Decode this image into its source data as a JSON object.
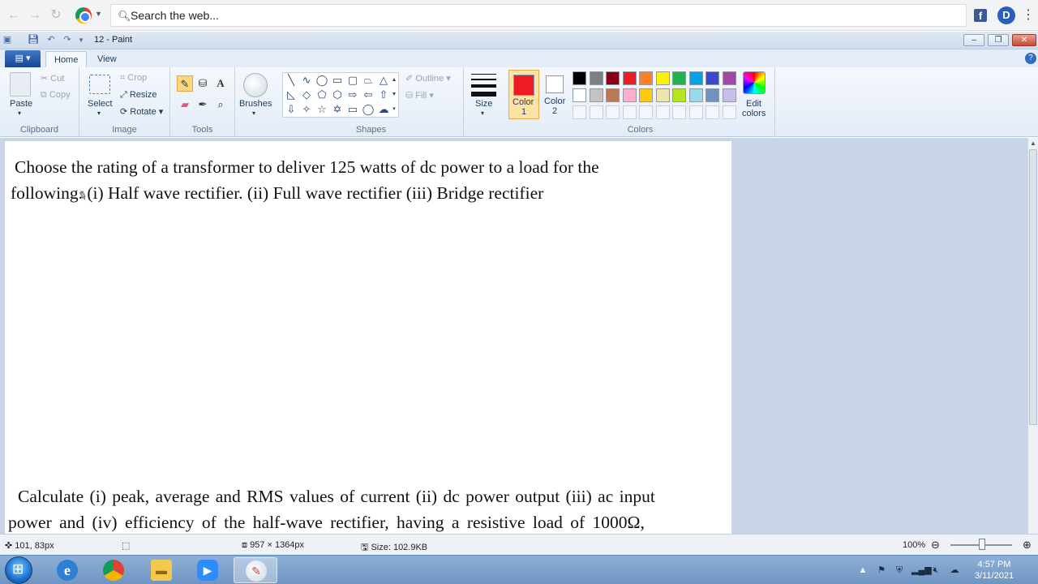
{
  "browser": {
    "search_placeholder": "Search the web...",
    "ext_facebook": "f",
    "ext_d": "D"
  },
  "window": {
    "title": "12 - Paint"
  },
  "ribbon": {
    "tabs": [
      "Home",
      "View"
    ],
    "clipboard": {
      "paste": "Paste",
      "cut": "Cut",
      "copy": "Copy",
      "label": "Clipboard"
    },
    "image": {
      "select": "Select",
      "crop": "Crop",
      "resize": "Resize",
      "rotate": "Rotate",
      "label": "Image"
    },
    "tools": {
      "label": "Tools",
      "text_tool": "A"
    },
    "brushes": {
      "label": "Brushes"
    },
    "shapes": {
      "outline": "Outline",
      "fill": "Fill",
      "label": "Shapes"
    },
    "size": {
      "label": "Size"
    },
    "colors": {
      "color1_label": "Color",
      "color1_num": "1",
      "color2_label": "Color",
      "color2_num": "2",
      "edit_label": "Edit",
      "edit_label2": "colors",
      "label": "Colors",
      "color1": "#ed1c24",
      "color2": "#ffffff",
      "palette_row1": [
        "#000000",
        "#7f7f7f",
        "#880015",
        "#ed1c24",
        "#ff7f27",
        "#fff200",
        "#22b14c",
        "#00a2e8",
        "#3f48cc",
        "#a349a4"
      ],
      "palette_row2": [
        "#ffffff",
        "#c3c3c3",
        "#b97a57",
        "#ffaec9",
        "#ffc90e",
        "#efe4b0",
        "#b5e61d",
        "#99d9ea",
        "#7092be",
        "#c8bfe7"
      ]
    }
  },
  "canvas": {
    "line1": "Choose the rating of a transformer to deliver 125 watts of dc power to a load for the",
    "line2": "following. (i) Half wave rectifier. (ii) Full wave rectifier (iii) Bridge rectifier",
    "line3": "Calculate (i) peak, average and RMS values of current (ii) dc power output (iii) ac input",
    "line4": "power and (iv) efficiency of the half-wave rectifier, having a resistive load of 1000Ω,"
  },
  "status": {
    "cursor_pos": "101, 83px",
    "image_dims": "957 × 1364px",
    "file_size": "Size: 102.9KB",
    "zoom": "100%"
  },
  "taskbar": {
    "time": "4:57 PM",
    "date": "3/11/2021"
  }
}
